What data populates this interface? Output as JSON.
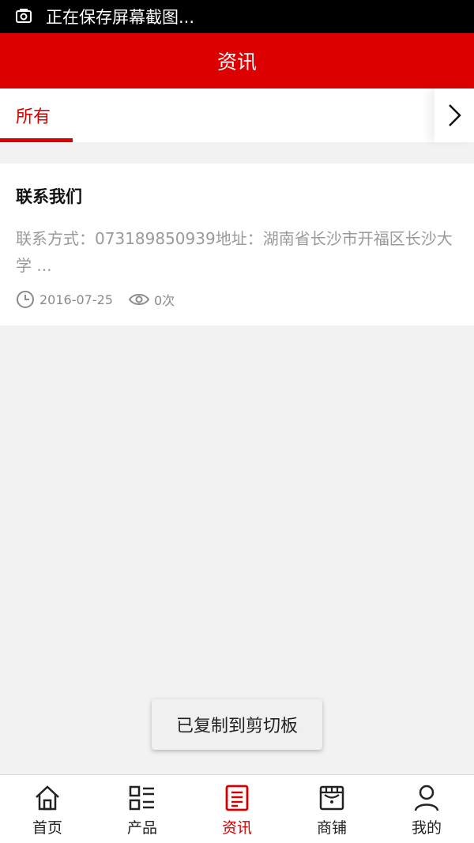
{
  "status_bar": {
    "text": "正在保存屏幕截图..."
  },
  "header": {
    "title": "资讯"
  },
  "categories": {
    "active_tab": "所有"
  },
  "news": [
    {
      "title": "联系我们",
      "summary": "联系方式：073189850939地址：湖南省长沙市开福区长沙大学 ...",
      "date": "2016-07-25",
      "views": "0次"
    }
  ],
  "toast": {
    "text": "已复制到剪切板"
  },
  "tab_bar": {
    "items": [
      {
        "label": "首页",
        "icon": "home-icon"
      },
      {
        "label": "产品",
        "icon": "list-icon"
      },
      {
        "label": "资讯",
        "icon": "news-icon"
      },
      {
        "label": "商铺",
        "icon": "shop-icon"
      },
      {
        "label": "我的",
        "icon": "user-icon"
      }
    ],
    "active_index": 2
  },
  "colors": {
    "accent": "#dc0000",
    "background": "#f2f2f2"
  }
}
